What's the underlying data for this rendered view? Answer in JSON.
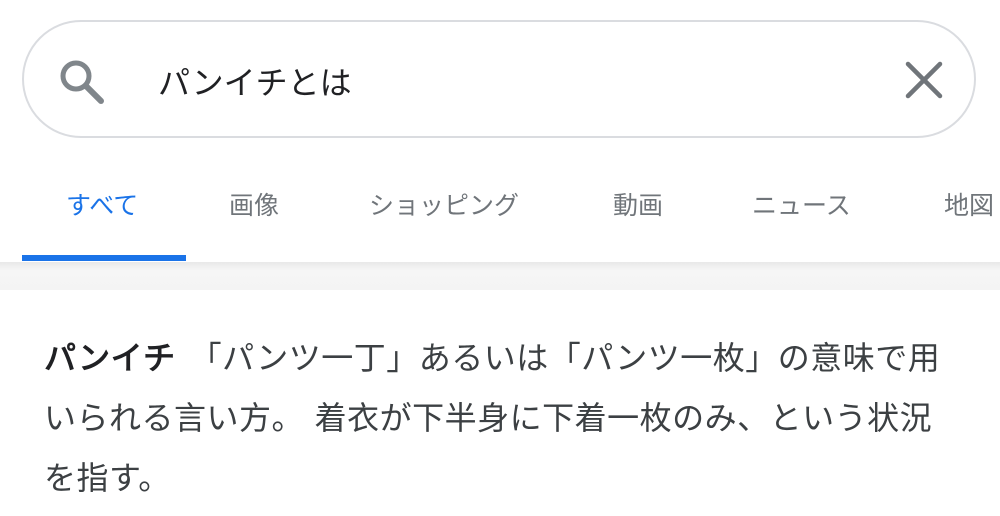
{
  "search": {
    "query": "パンイチとは"
  },
  "tabs": [
    {
      "label": "すべて",
      "active": true
    },
    {
      "label": "画像",
      "active": false
    },
    {
      "label": "ショッピング",
      "active": false
    },
    {
      "label": "動画",
      "active": false
    },
    {
      "label": "ニュース",
      "active": false
    },
    {
      "label": "地図",
      "active": false
    }
  ],
  "result": {
    "term": "パンイチ",
    "definition": "「パンツ一丁」あるいは「パンツ一枚」の意味で用いられる言い方。 着衣が下半身に下着一枚のみ、という状況を指す。"
  },
  "colors": {
    "accent": "#1a73e8",
    "tab_text": "#70757a",
    "body_text": "#3c4043"
  },
  "icons": {
    "search": "search-icon",
    "clear": "close-icon"
  }
}
